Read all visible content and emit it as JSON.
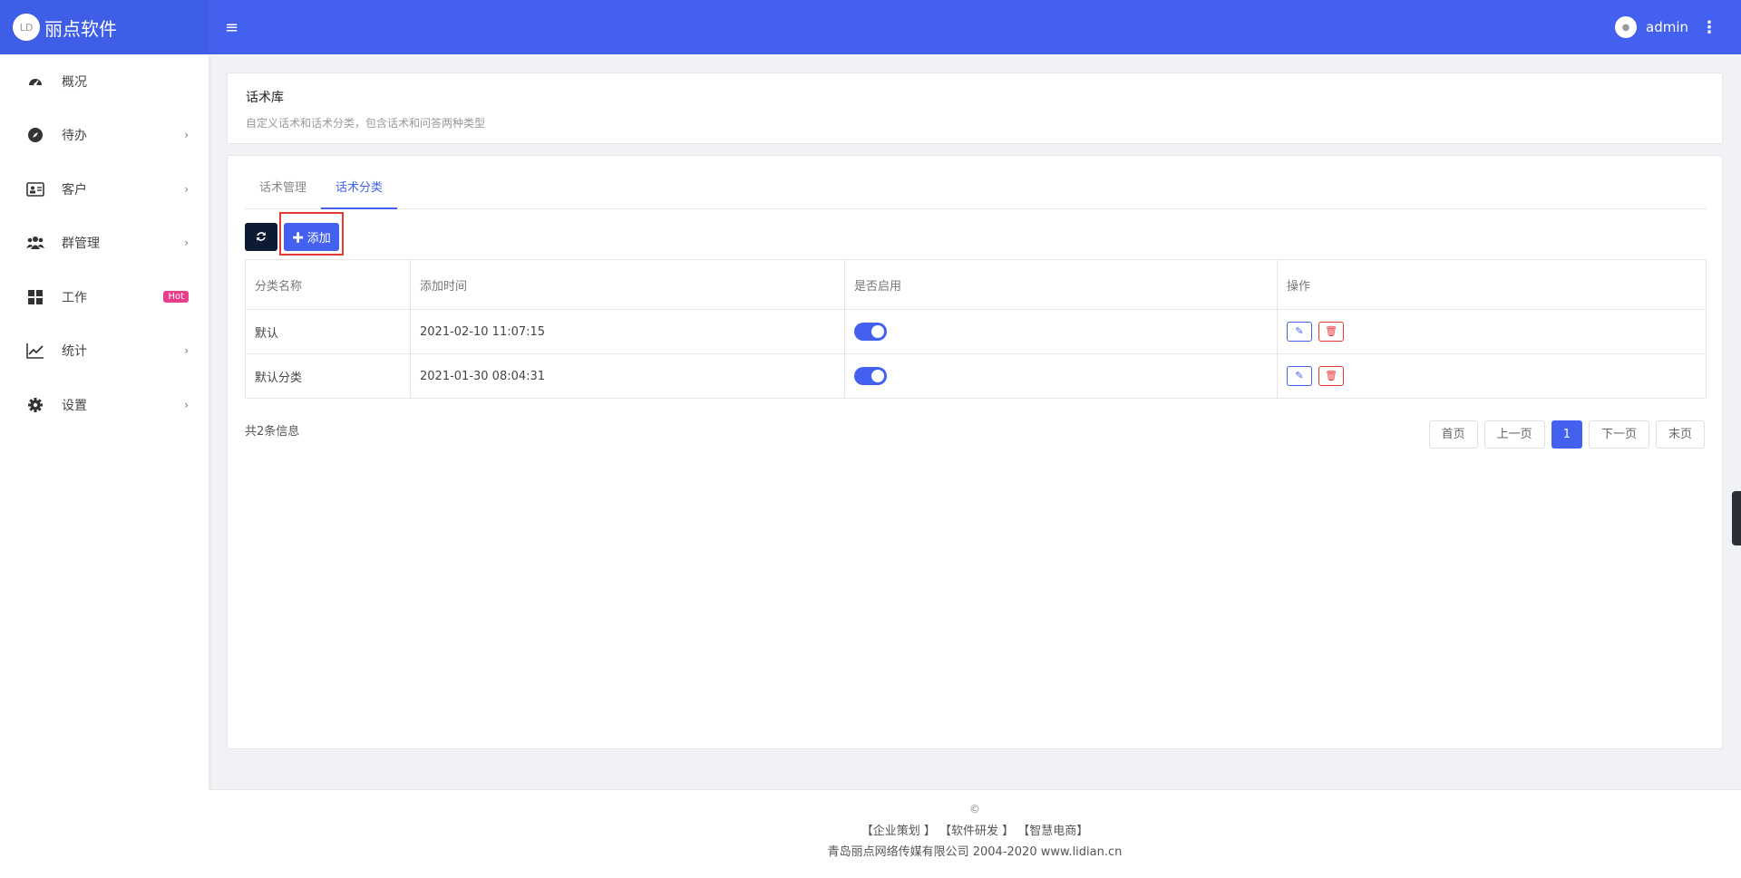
{
  "app": {
    "brand": "丽点软件",
    "logo_text": "LD"
  },
  "header": {
    "user_name": "admin",
    "menu_icon": "hamburger-icon",
    "more_icon": "kebab-icon"
  },
  "sidebar": {
    "items": [
      {
        "label": "概况",
        "icon": "dashboard-icon",
        "arrow": ""
      },
      {
        "label": "待办",
        "icon": "compass-icon",
        "arrow": "›"
      },
      {
        "label": "客户",
        "icon": "id-card-icon",
        "arrow": "›"
      },
      {
        "label": "群管理",
        "icon": "users-icon",
        "arrow": "›"
      },
      {
        "label": "工作",
        "icon": "grid-icon",
        "badge": "Hot"
      },
      {
        "label": "统计",
        "icon": "chart-line-icon",
        "arrow": "›"
      },
      {
        "label": "设置",
        "icon": "gear-icon",
        "arrow": "›"
      }
    ]
  },
  "page": {
    "title": "话术库",
    "description": "自定义话术和话术分类，包含话术和问答两种类型"
  },
  "tabs": [
    {
      "label": "话术管理"
    },
    {
      "label": "话术分类"
    }
  ],
  "toolbar": {
    "refresh_icon": "refresh-icon",
    "add_label": "添加"
  },
  "table": {
    "headers": [
      "分类名称",
      "添加时间",
      "是否启用",
      "操作"
    ],
    "rows": [
      {
        "name": "默认",
        "time": "2021-02-10 11:07:15",
        "enabled": true
      },
      {
        "name": "默认分类",
        "time": "2021-01-30 08:04:31",
        "enabled": true
      }
    ]
  },
  "total_text": "共2条信息",
  "pagination": {
    "first": "首页",
    "prev": "上一页",
    "current": "1",
    "next": "下一页",
    "last": "末页"
  },
  "footer": {
    "copyright": "©",
    "links": "【企业策划 】 【软件研发 】 【智慧电商】",
    "company": "青岛丽点网络传媒有限公司 2004-2020 www.lidian.cn"
  },
  "colors": {
    "accent": "#4361ee",
    "dark": "#0c1b33",
    "danger": "#e53935",
    "hot": "#e83e8c"
  }
}
